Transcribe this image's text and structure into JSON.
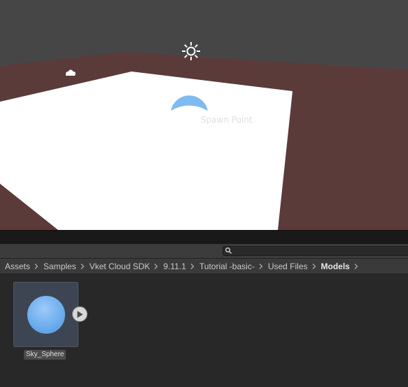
{
  "scene": {
    "spawn_label": "Spawn Point",
    "colors": {
      "sky": "#464646",
      "ground": "#5b3a3a",
      "floor": "#ffffff",
      "spawn_dome": "#7fbbf0"
    },
    "gizmos": [
      "sun-icon",
      "cloud-icon",
      "spawn-dome-icon"
    ]
  },
  "project": {
    "search": {
      "placeholder": "",
      "value": ""
    },
    "breadcrumb": [
      "Assets",
      "Samples",
      "Vket Cloud SDK",
      "9.11.1",
      "Tutorial -basic-",
      "Used Files",
      "Models"
    ],
    "assets": [
      {
        "name": "Sky_Sphere",
        "icon": "sphere-thumbnail",
        "selected": true
      }
    ]
  }
}
